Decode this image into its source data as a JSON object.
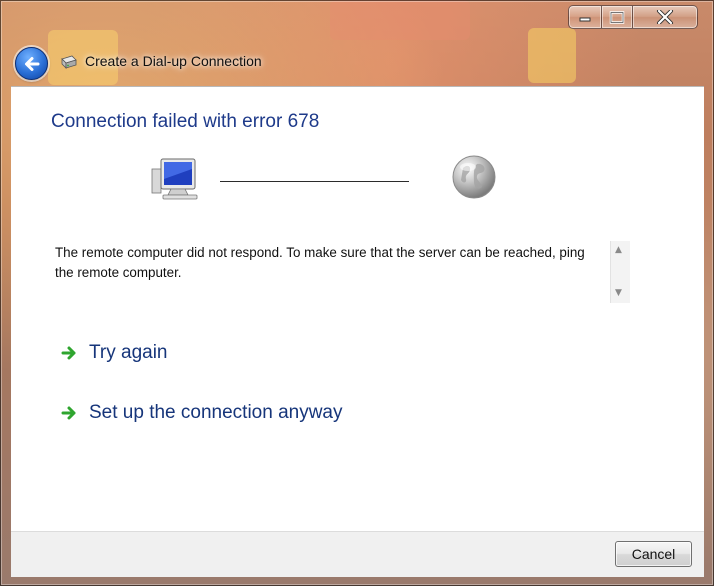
{
  "window": {
    "title": "Create a Dial-up Connection",
    "caption_buttons": [
      "minimize",
      "maximize",
      "close"
    ]
  },
  "header": {
    "back_icon": "back-arrow-icon",
    "app_icon": "dialup-modem-icon"
  },
  "main": {
    "heading": "Connection failed with error 678",
    "diagram": {
      "left_icon": "computer-icon",
      "right_icon": "globe-icon"
    },
    "message": "The remote computer did not respond. To make sure that the server can be reached, ping the remote computer.",
    "actions": [
      {
        "label": "Try again",
        "icon": "green-arrow-icon"
      },
      {
        "label": "Set up the connection anyway",
        "icon": "green-arrow-icon"
      }
    ]
  },
  "footer": {
    "cancel_label": "Cancel"
  },
  "colors": {
    "heading": "#1e3a8a",
    "link": "#16357a",
    "arrow_green": "#2fa52f",
    "back_button": "#2a6fd6"
  }
}
